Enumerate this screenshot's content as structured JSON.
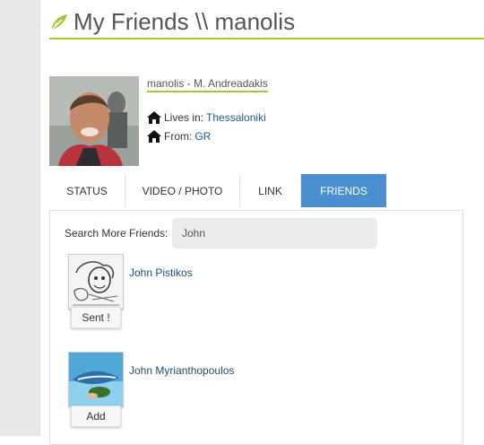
{
  "page": {
    "title": "My Friends \\\\ manolis"
  },
  "profile": {
    "name": "manolis - M. Andreadakis",
    "lives_in_label": "Lives in:",
    "lives_in_value": "Thessaloniki",
    "from_label": "From:",
    "from_value": "GR"
  },
  "tabs": [
    {
      "label": "STATUS",
      "active": false
    },
    {
      "label": "VIDEO / PHOTO",
      "active": false
    },
    {
      "label": "LINK",
      "active": false
    },
    {
      "label": "FRIENDS",
      "active": true
    }
  ],
  "search": {
    "label": "Search More Friends:",
    "value": "John"
  },
  "friends": [
    {
      "name": "John Pistikos",
      "button": "Sent !"
    },
    {
      "name": "John Myrianthopoulos",
      "button": "Add"
    }
  ],
  "colors": {
    "accent_green": "#a9c63a",
    "tab_active": "#4a90d0",
    "link_blue": "#1f5d8a"
  }
}
